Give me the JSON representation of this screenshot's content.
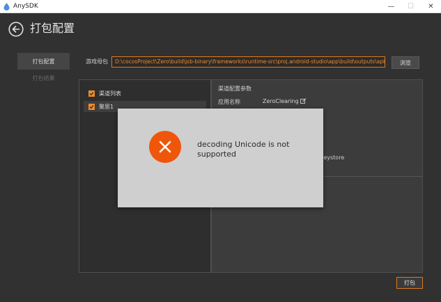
{
  "window": {
    "title": "AnySDK",
    "minimize_glyph": "—",
    "maximize_glyph": "☐",
    "close_glyph": "✕"
  },
  "header": {
    "title": "打包配置",
    "back_icon": "back-arrow-icon"
  },
  "nav": {
    "items": [
      {
        "label": "打包配置",
        "active": true
      },
      {
        "label": "打包结果",
        "active": false
      }
    ]
  },
  "package": {
    "label": "游戏母包",
    "path": "D:\\cocosProject\\Zero\\build\\jsb-binary\\frameworks\\runtime-src\\proj.android-studio\\app\\build\\outputs\\apk\\Zero-re",
    "browse_label": "浏览"
  },
  "channels": {
    "items": [
      {
        "label": "渠道列表",
        "checked": true
      },
      {
        "label": "聚思1",
        "checked": true
      }
    ]
  },
  "config": {
    "title": "渠道配置参数",
    "app_name_label": "应用名称",
    "app_name_value": "ZeroClearing",
    "keystore_text": "keystore"
  },
  "actions": {
    "pack_label": "打包"
  },
  "dialog": {
    "message": "decoding Unicode is not supported",
    "icon": "error-x-icon"
  },
  "colors": {
    "accent": "#f08a2a",
    "error": "#f0560a",
    "background": "#313131"
  }
}
